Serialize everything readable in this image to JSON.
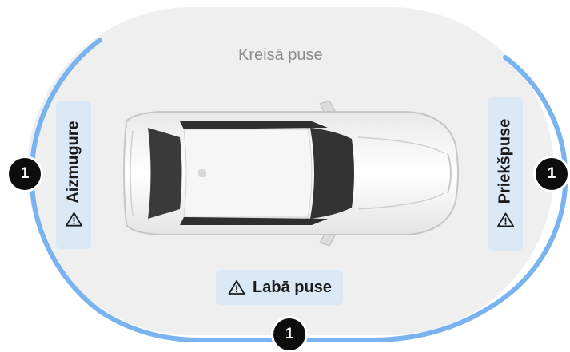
{
  "labels": {
    "top": "Kreisā puse",
    "left": "Aizmugure",
    "right": "Priekšpuse",
    "bottom": "Labā puse"
  },
  "badges": {
    "left": "1",
    "right": "1",
    "bottom": "1"
  },
  "icons": {
    "warning": "warning-triangle-icon"
  },
  "colors": {
    "arc": "#7ab4f0",
    "tag_bg": "#dbe9f7",
    "badge_bg": "#0d0d0d",
    "track_bg": "#efefef"
  }
}
